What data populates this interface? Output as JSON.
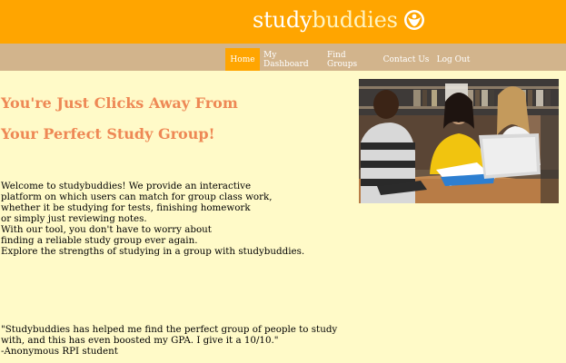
{
  "header": {
    "logo_part1": "study",
    "logo_part2": "buddies"
  },
  "nav": {
    "items": [
      {
        "label": "Home",
        "active": true
      },
      {
        "label": "My Dashboard",
        "active": false
      },
      {
        "label": "Find Groups",
        "active": false
      },
      {
        "label": "Contact Us",
        "active": false
      },
      {
        "label": "Log Out",
        "active": false
      }
    ]
  },
  "main": {
    "headline_line1": "You're Just Clicks Away From",
    "headline_line2": "Your Perfect Study Group!",
    "intro_lines": [
      "Welcome to studybuddies! We provide an interactive",
      "platform on which users can match for group class work,",
      "whether it be studying for tests, finishing homework",
      "or simply just reviewing notes.",
      "With our tool, you don't have to worry about",
      "finding a reliable study group ever again.",
      "Explore the strengths of studying in a group with studybuddies."
    ],
    "quote_lines": [
      "\"Studybuddies has helped me find the perfect group of people to study",
      "with, and this has even boosted my GPA. I give it a 10/10.\"",
      "-Anonymous RPI student"
    ]
  },
  "colors": {
    "header_bg": "#ffa500",
    "nav_bg": "#d2b48c",
    "page_bg": "#fffac8",
    "headline": "#ee8855"
  }
}
